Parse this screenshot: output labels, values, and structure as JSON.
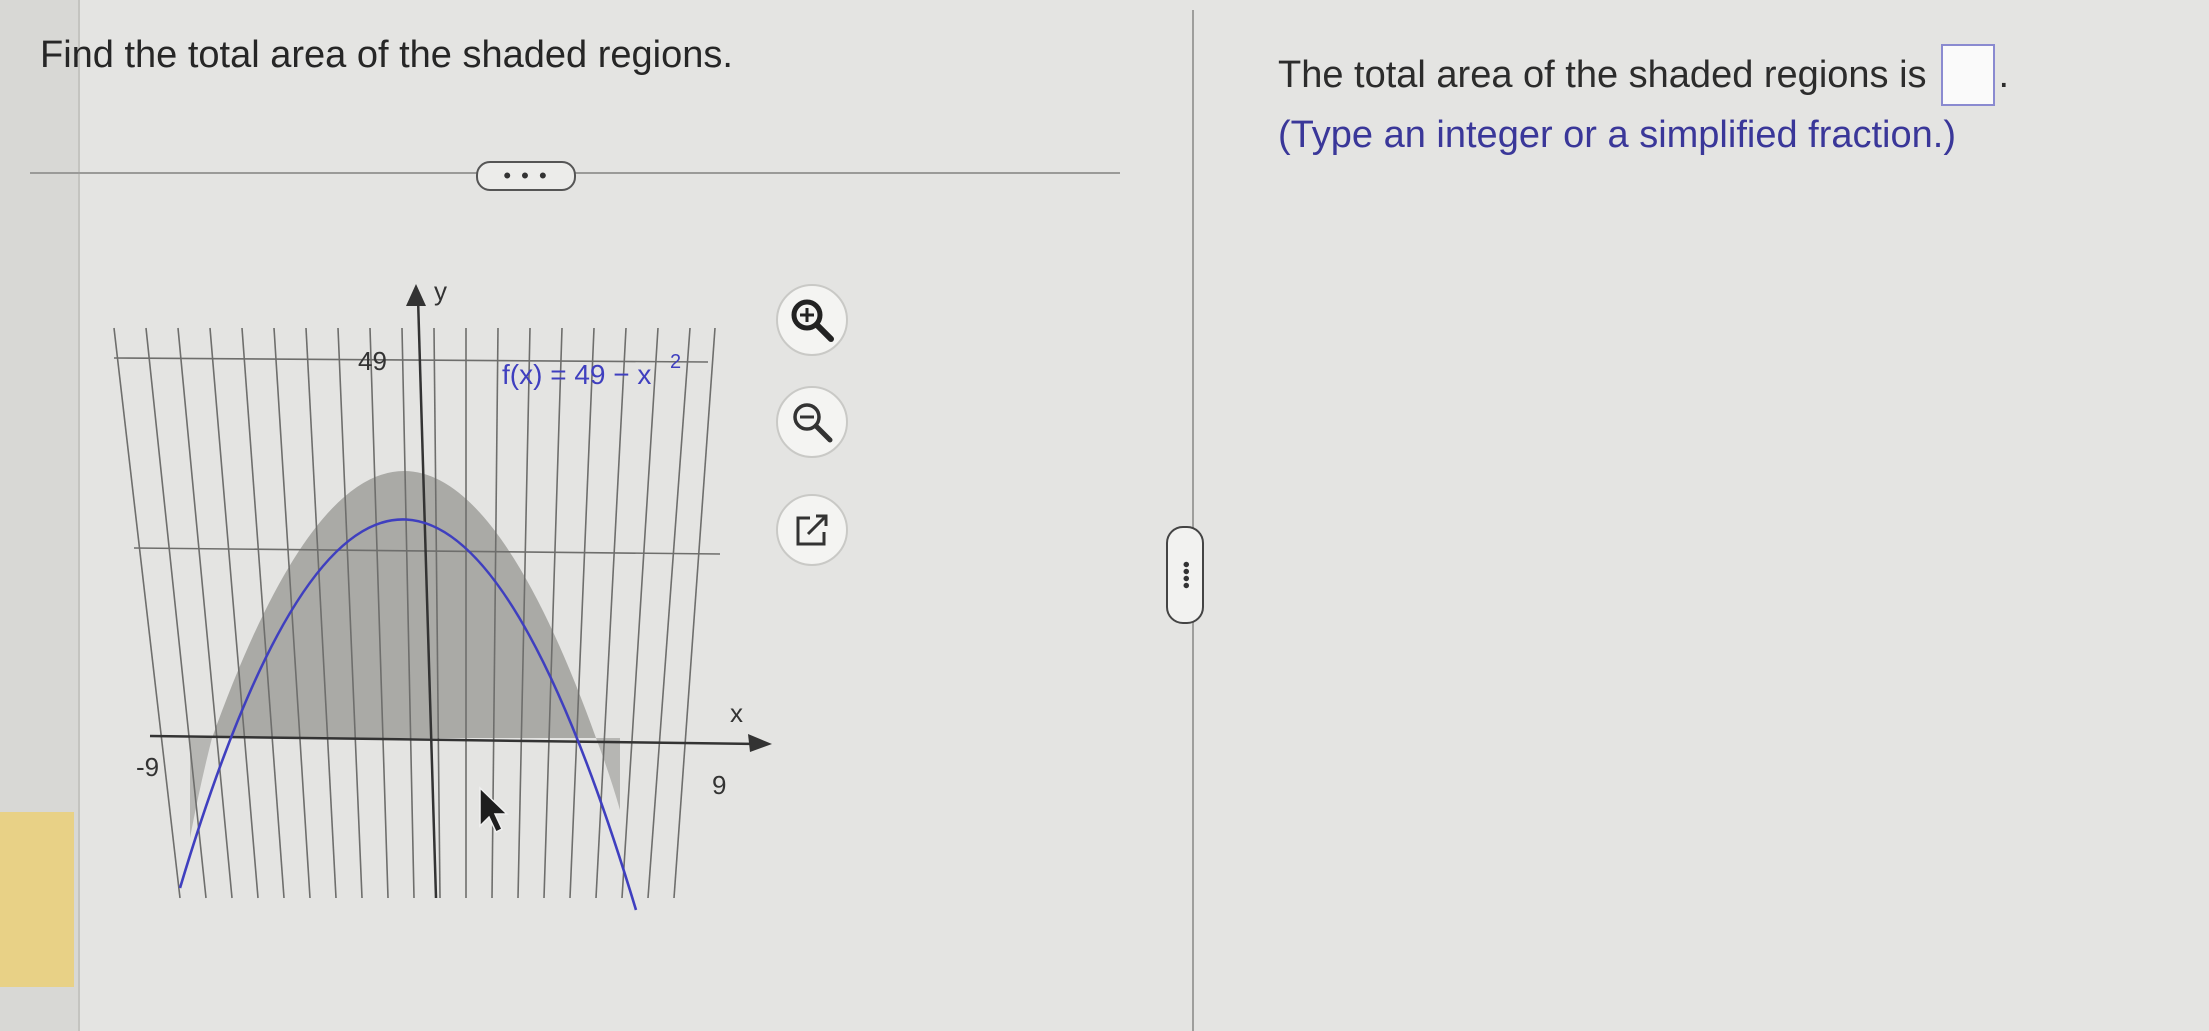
{
  "question": {
    "text": "Find the total area of the shaded regions."
  },
  "more_button": {
    "label": "• • •"
  },
  "graph": {
    "function_label": "f(x) = 49 − x",
    "exponent": "2",
    "y_axis_label": "y",
    "x_axis_label": "x",
    "y_tick_label": "49",
    "x_min_label": "-9",
    "x_max_label": "9",
    "curve_color": "#3f3fbf",
    "shade_color": "#a3a3a0"
  },
  "tools": {
    "zoom_in": "zoom-in-icon",
    "zoom_out": "zoom-out-icon",
    "expand": "external-link-icon"
  },
  "splitter": {
    "label": "••••"
  },
  "answer": {
    "prompt": "The total area of the shaded regions is",
    "period": ".",
    "value": "",
    "hint": "(Type an integer or a simplified fraction.)"
  }
}
